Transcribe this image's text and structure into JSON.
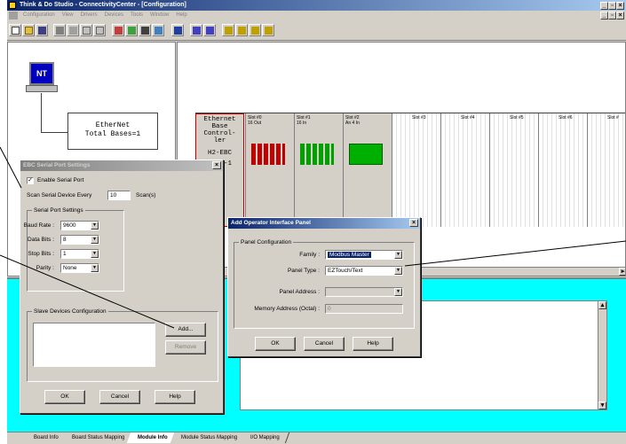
{
  "app": {
    "title": "Think & Do Studio - ConnectivityCenter - [Configuration]",
    "menu": [
      "Configuration",
      "View",
      "Drivers",
      "Devices",
      "Tools",
      "Window",
      "Help"
    ]
  },
  "tree": {
    "root_icon_label": "NT",
    "node_line1": "EtherNet",
    "node_line2": "Total Bases=1"
  },
  "rack": {
    "controller": {
      "line1": "Ethernet",
      "line2": "Base",
      "line3": "Control-",
      "line4": "ler",
      "line5": "H2-EBC",
      "line6": "Base-1"
    },
    "slots": [
      {
        "name": "Slot #0",
        "desc": "16 Out"
      },
      {
        "name": "Slot #1",
        "desc": "16 In"
      },
      {
        "name": "Slot #2",
        "desc": "An 4 In"
      },
      {
        "name": "Slot #3",
        "desc": ""
      },
      {
        "name": "Slot #4",
        "desc": ""
      },
      {
        "name": "Slot #5",
        "desc": ""
      },
      {
        "name": "Slot #6",
        "desc": ""
      },
      {
        "name": "Slot #",
        "desc": ""
      }
    ]
  },
  "ebc_dialog": {
    "title": "EBC Serial Port Settings",
    "enable_label": "Enable Serial Port",
    "enable_checked": true,
    "scan_prefix": "Scan Serial Device Every",
    "scan_value": "10",
    "scan_suffix": "Scan(s)",
    "serial_group": "Serial Port Settings",
    "baud_label": "Baud Rate :",
    "baud_value": "9600",
    "data_label": "Data Bits :",
    "data_value": "8",
    "stop_label": "Stop Bits :",
    "stop_value": "1",
    "parity_label": "Parity :",
    "parity_value": "None",
    "slave_group": "Slave Devices Configuration",
    "add_label": "Add...",
    "remove_label": "Remove",
    "ok_label": "OK",
    "cancel_label": "Cancel",
    "help_label": "Help"
  },
  "oip_dialog": {
    "title": "Add Operator Interface Panel",
    "group": "Panel Configuration",
    "family_label": "Family :",
    "family_value": "Modbus Master",
    "type_label": "Panel Type :",
    "type_value": "EZTouch/Text",
    "address_label": "Panel Address :",
    "address_value": "",
    "memory_label": "Memory Address (Octal) :",
    "memory_value": "0",
    "ok_label": "OK",
    "cancel_label": "Cancel",
    "help_label": "Help"
  },
  "tabs": [
    "Board Info",
    "Board Status Mapping",
    "Module Info",
    "Module Status Mapping",
    "I/O Mapping"
  ],
  "active_tab": "Module Info",
  "colors": {
    "titlebar": "#0a246a",
    "bottom_pane": "#00ffff",
    "controller_border": "#c00000",
    "output_leds": "#c00000",
    "input_leds": "#00a000"
  }
}
